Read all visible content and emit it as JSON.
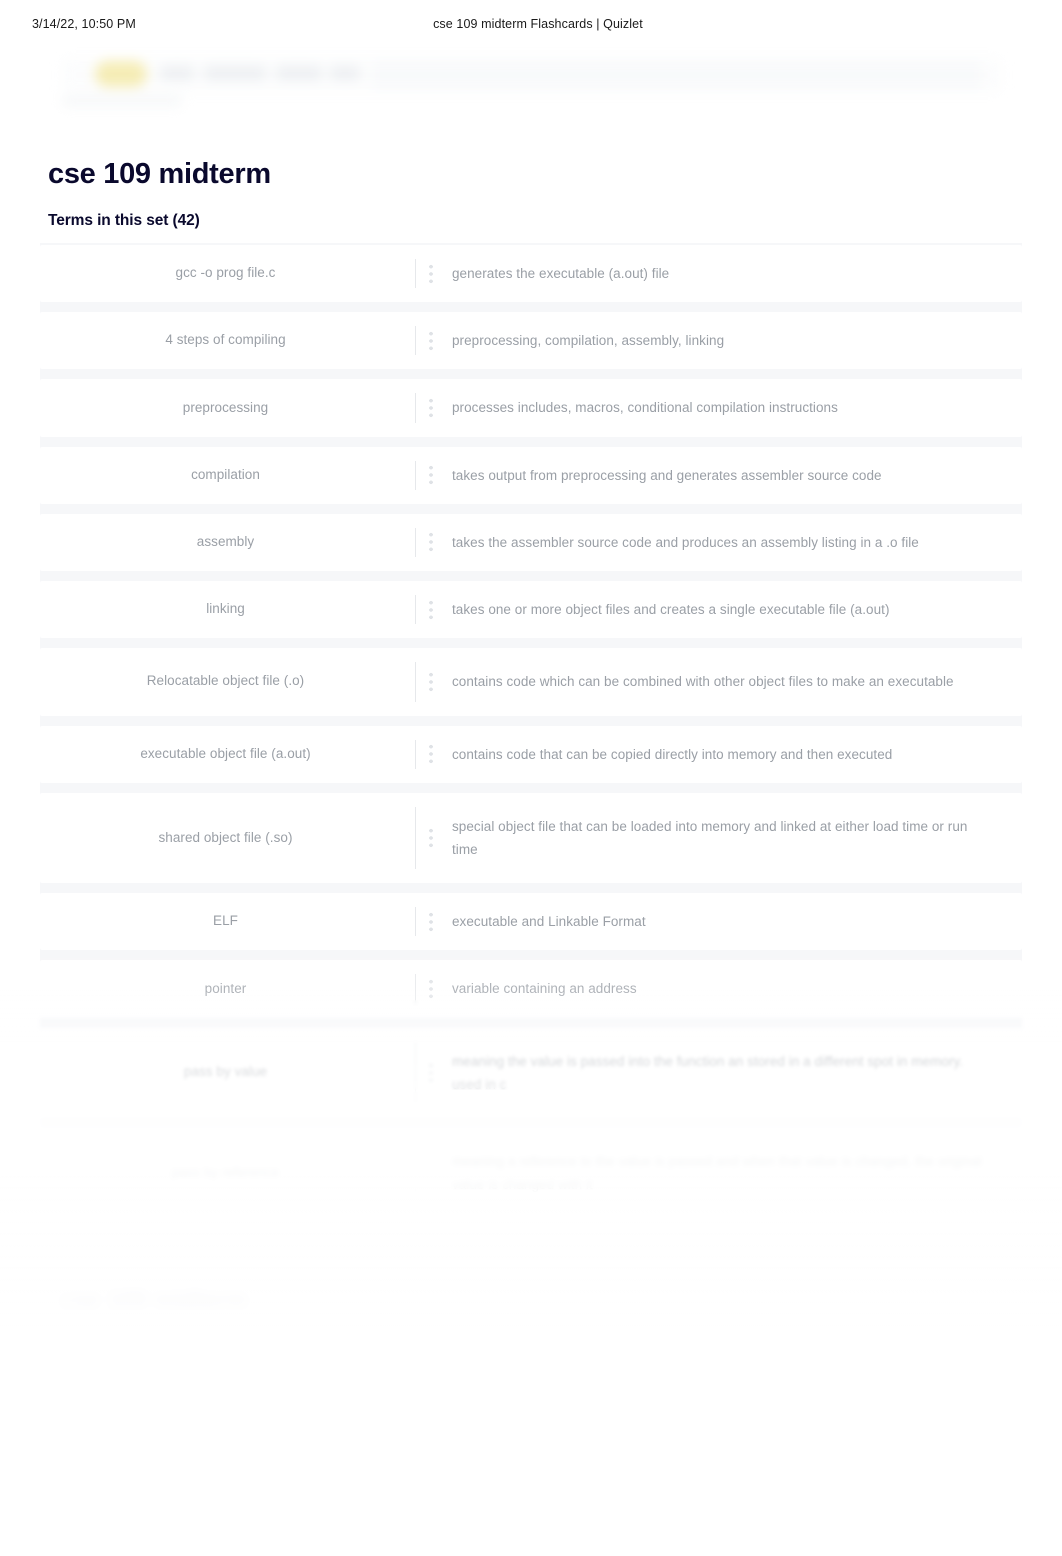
{
  "print_header": {
    "timestamp": "3/14/22, 10:50 PM",
    "document_title": "cse 109 midterm Flashcards | Quizlet"
  },
  "site_chrome": {
    "logo_label": "Quizlet",
    "search_placeholder": "Search"
  },
  "set": {
    "title": "cse 109 midterm",
    "terms_count_label": "Terms in this set (42)",
    "total_terms": 42
  },
  "ghost_next_page_heading": "cse 109 midterm",
  "terms": [
    {
      "term": "gcc -o prog file.c",
      "definition": "generates the executable (a.out) file",
      "tall": false
    },
    {
      "term": "4 steps of compiling",
      "definition": "preprocessing, compilation, assembly, linking",
      "tall": false
    },
    {
      "term": "preprocessing",
      "definition": "processes includes, macros, conditional compilation instructions",
      "tall": false
    },
    {
      "term": "compilation",
      "definition": "takes output from preprocessing and generates assembler source code",
      "tall": false
    },
    {
      "term": "assembly",
      "definition": "takes the assembler source code and produces an assembly listing in a .o file",
      "tall": false
    },
    {
      "term": "linking",
      "definition": "takes one or more object files and creates a single executable file (a.out)",
      "tall": false
    },
    {
      "term": "Relocatable object file (.o)",
      "definition": "contains code which can be combined with other object files to make an executable",
      "tall": true
    },
    {
      "term": "executable object file (a.out)",
      "definition": "contains code that can be copied directly into memory and then executed",
      "tall": false
    },
    {
      "term": "shared object file (.so)",
      "definition": "special object file that can be loaded into memory and linked at either load time or run time",
      "tall": true
    },
    {
      "term": "ELF",
      "definition": "executable and Linkable Format",
      "tall": false
    },
    {
      "term": "pointer",
      "definition": "variable containing an address",
      "tall": false
    },
    {
      "term": "pass by value",
      "definition": "meaning the value is passed into the function an stored in a different spot in memory. used in c",
      "tall": true
    },
    {
      "term": "pass by reference",
      "definition": "meaning a reference to the value is passed and when that value is changed, the original value is changed with it",
      "tall": true
    }
  ]
}
